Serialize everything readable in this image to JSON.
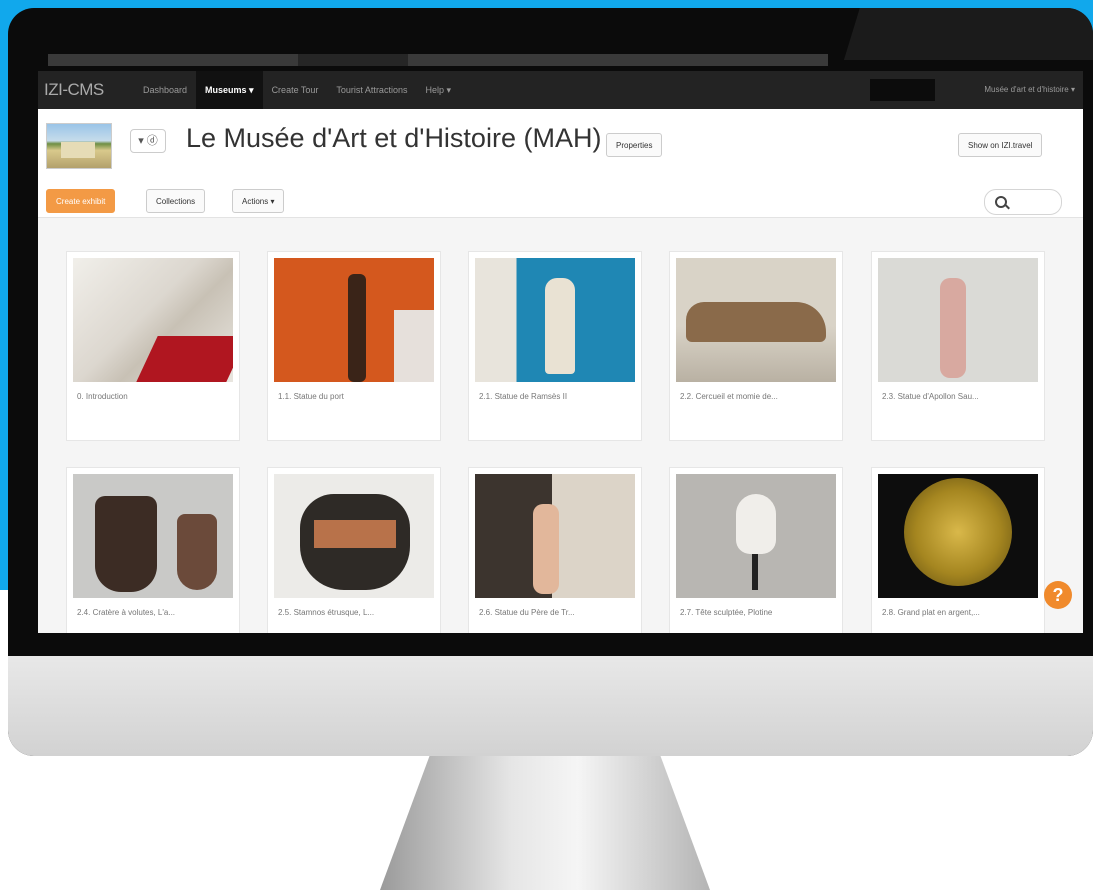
{
  "navbar": {
    "brand": "IZI-CMS",
    "items": [
      {
        "label": "Dashboard"
      },
      {
        "label": "Museums ▾"
      },
      {
        "label": "Create Tour"
      },
      {
        "label": "Tourist Attractions"
      },
      {
        "label": "Help ▾"
      }
    ],
    "user": "Musée d'art et d'histoire ▾"
  },
  "header": {
    "language": "▾ ⓓ",
    "title": "Le Musée d'Art et d'Histoire (MAH)",
    "properties_label": "Properties",
    "show_label": "Show on IZI.travel"
  },
  "toolbar": {
    "create_label": "Create exhibit",
    "collections_label": "Collections",
    "actions_label": "Actions ▾"
  },
  "exhibits": [
    {
      "label": "0. Introduction",
      "image": "staircase-photo"
    },
    {
      "label": "1.1. Statue du port",
      "image": "wooden-statue-photo"
    },
    {
      "label": "2.1. Statue de Ramsès II",
      "image": "ramses-statue-photo"
    },
    {
      "label": "2.2. Cercueil et momie de...",
      "image": "coffin-photo"
    },
    {
      "label": "2.3. Statue d'Apollon Sau...",
      "image": "apollo-statue-photo"
    },
    {
      "label": "2.4. Cratère à volutes, L'a...",
      "image": "crater-vase-photo"
    },
    {
      "label": "2.5. Stamnos étrusque, L...",
      "image": "stamnos-photo"
    },
    {
      "label": "2.6. Statue du Père de Tr...",
      "image": "father-statue-photo"
    },
    {
      "label": "2.7. Tête sculptée, Plotine",
      "image": "sculpted-head-photo"
    },
    {
      "label": "2.8. Grand plat en argent,...",
      "image": "silver-plate-photo"
    }
  ],
  "help": {
    "label": "?"
  },
  "colors": {
    "background_accent": "#11a8ec",
    "primary_button": "#f39a45",
    "navbar": "#232323",
    "help_bubble": "#f08a2c"
  }
}
